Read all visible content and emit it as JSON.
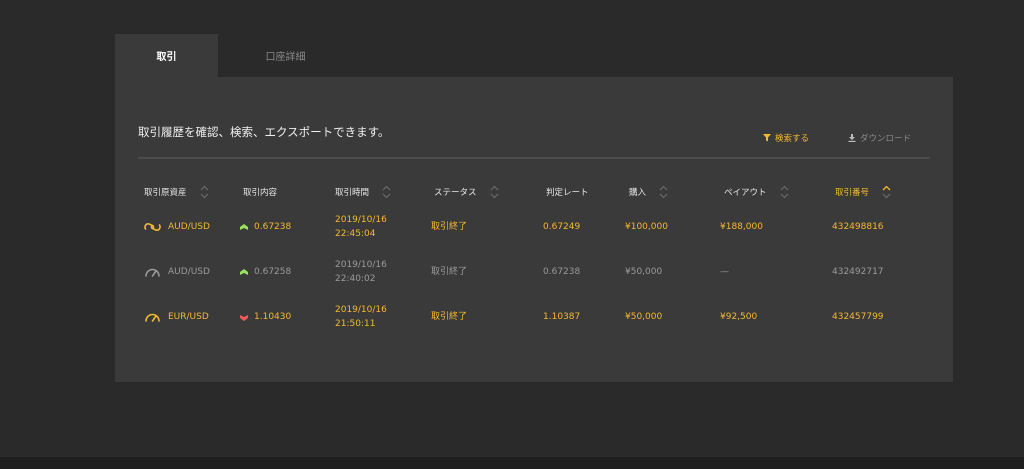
{
  "tabs": [
    {
      "label": "取引"
    },
    {
      "label": "口座詳細"
    }
  ],
  "panel": {
    "description": "取引履歴を確認、検索、エクスポートできます。",
    "search_label": "検索する",
    "download_label": "ダウンロード"
  },
  "table": {
    "headers": {
      "asset": "取引原資産",
      "content": "取引内容",
      "time": "取引時間",
      "status": "ステータス",
      "rate": "判定レート",
      "purchase": "購入",
      "payout": "ペイアウト",
      "id": "取引番号"
    },
    "rows": [
      {
        "asset": "AUD/USD",
        "asset_icon": "link-icon",
        "direction_icon": "arrow-up-icon",
        "content": "0.67238",
        "date": "2019/10/16",
        "clock": "22:45:04",
        "status": "取引終了",
        "rate": "0.67249",
        "purchase": "¥100,000",
        "payout": "¥188,000",
        "id": "432498816"
      },
      {
        "asset": "AUD/USD",
        "asset_icon": "gauge-icon",
        "direction_icon": "arrow-up-icon",
        "content": "0.67258",
        "date": "2019/10/16",
        "clock": "22:40:02",
        "status": "取引終了",
        "rate": "0.67238",
        "purchase": "¥50,000",
        "payout": "—",
        "id": "432492717"
      },
      {
        "asset": "EUR/USD",
        "asset_icon": "gauge-icon",
        "direction_icon": "arrow-down-icon",
        "content": "1.10430",
        "date": "2019/10/16",
        "clock": "21:50:11",
        "status": "取引終了",
        "rate": "1.10387",
        "purchase": "¥50,000",
        "payout": "¥92,500",
        "id": "432457799"
      }
    ]
  },
  "colors": {
    "accent": "#f5b82e",
    "up": "#9be15d",
    "down": "#ef5b5b",
    "muted": "#9a9a9a"
  }
}
